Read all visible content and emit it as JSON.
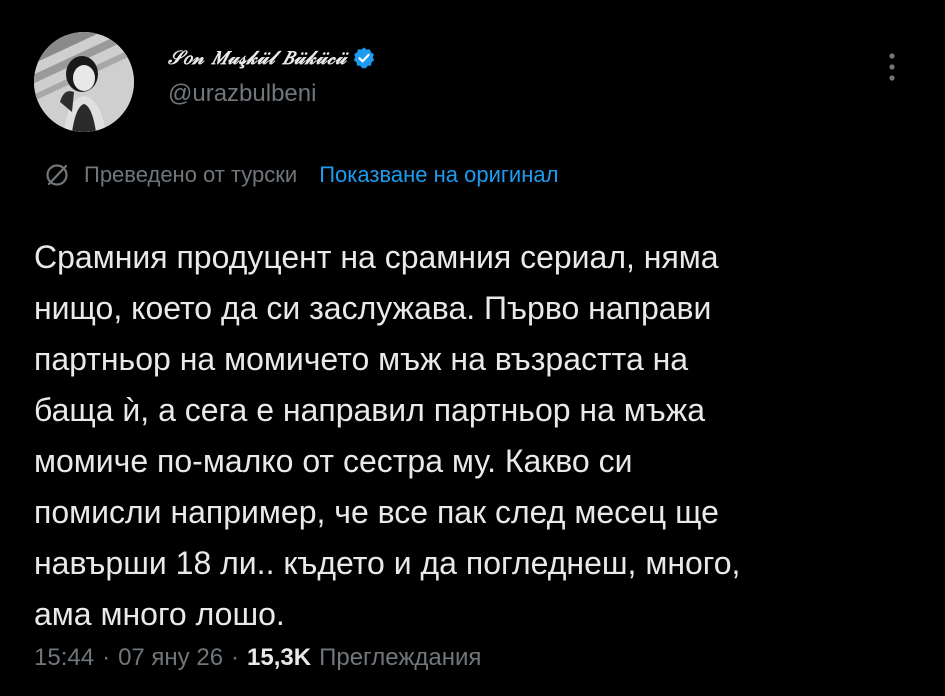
{
  "author": {
    "display_name": "𝒮𝑜𝓃 𝑀𝓊𝓈̧𝓀𝓊̈𝓁 𝐵𝓊̈𝓀𝓊̈𝒸𝓊̈",
    "handle": "@urazbulbeni",
    "verified": true,
    "avatar_icon": "profile-photo"
  },
  "menu": {
    "more_icon": "more-vertical-icon"
  },
  "translation": {
    "label": "Преведено от турски",
    "show_original": "Показване на оригинал",
    "icon": "translate-globe-icon"
  },
  "tweet": {
    "lines": [
      "Срамния продуцент на срамния сериал, няма",
      "нищо, което да си заслужава. Първо направи",
      "партньор на момичето мъж на възрастта на",
      "баща ѝ, а сега е направил партньор на мъжа",
      "момиче по-малко от сестра му. Какво си",
      "помисли например, че все пак след месец ще",
      "навърши 18 ли.. където и да погледнеш, много,",
      "ама много лошо."
    ]
  },
  "meta": {
    "time": "15:44",
    "separator": "·",
    "date": "07 яну 26",
    "views_count": "15,3K",
    "views_label": "Преглеждания"
  },
  "colors": {
    "background": "#000000",
    "text": "#e7e9ea",
    "secondary": "#71767b",
    "link": "#1d9bf0",
    "verified": "#1d9bf0"
  }
}
